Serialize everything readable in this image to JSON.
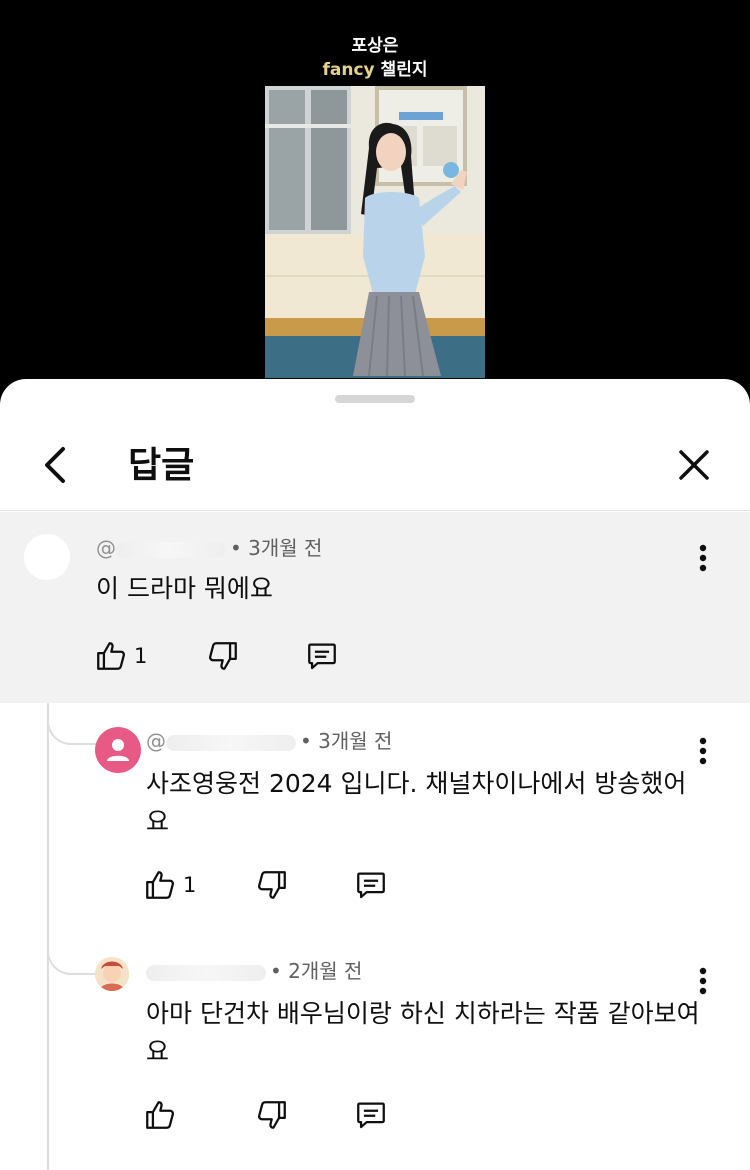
{
  "video": {
    "caption_line1": "포상은",
    "caption_line2_highlight": "fancy",
    "caption_line2_rest": " 챌린지"
  },
  "sheet": {
    "title": "답글"
  },
  "comments": [
    {
      "handle": "@",
      "time": "• 3개월 전",
      "text": "이 드라마 뭐에요",
      "likes": "1",
      "avatar": "blank"
    },
    {
      "handle": "@",
      "time": "• 3개월 전",
      "text": "사조영웅전 2024 입니다. 채널차이나에서  방송했어요",
      "likes": "1",
      "avatar": "pink-person"
    },
    {
      "handle": "",
      "time": "• 2개월 전",
      "text": "아마 단건차 배우님이랑 하신 치하라는 작품 같아보여요",
      "likes": "",
      "avatar": "illustration"
    }
  ],
  "colors": {
    "caption_highlight": "#e7d28a",
    "parent_bg": "#f2f2f2",
    "avatar_pink": "#e85a86"
  }
}
